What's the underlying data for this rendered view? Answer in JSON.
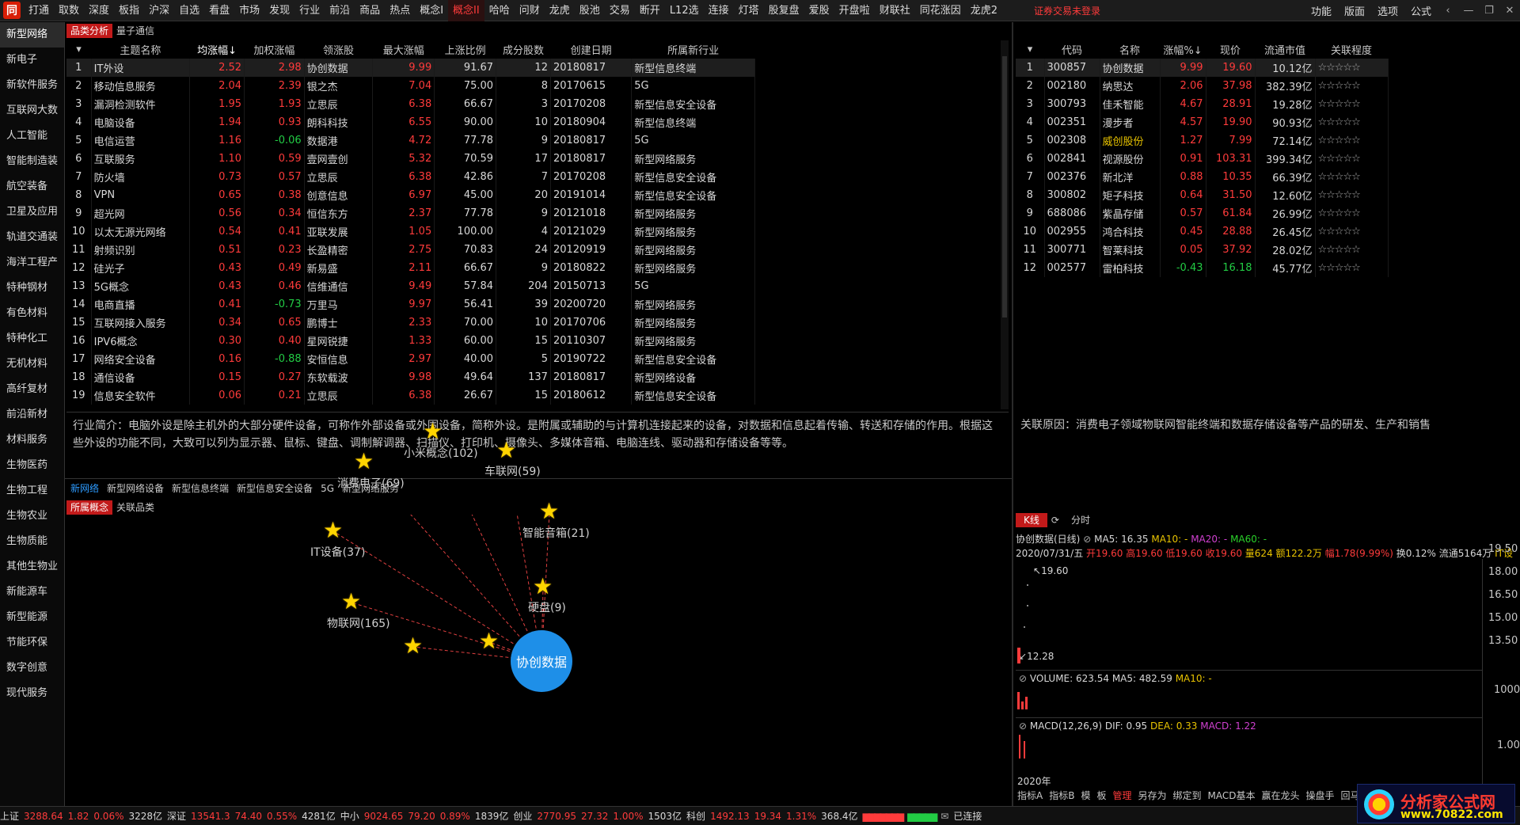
{
  "menubar": {
    "items": [
      "打通",
      "取数",
      "深度",
      "板指",
      "沪深",
      "自选",
      "看盘",
      "市场",
      "发现",
      "行业",
      "前沿",
      "商品",
      "热点",
      "概念I",
      "概念II",
      "哈哈",
      "问财",
      "龙虎",
      "股池",
      "交易",
      "断开",
      "L12选",
      "连接",
      "灯塔",
      "股复盘",
      "爱股",
      "开盘啦",
      "财联社",
      "同花涨因",
      "龙虎2"
    ],
    "active_index": 14,
    "center_text": "证券交易未登录",
    "right_items": [
      "功能",
      "版面",
      "选项",
      "公式"
    ]
  },
  "sidebar": {
    "items": [
      "新型网络",
      "新电子",
      "新软件服务",
      "互联网大数",
      "人工智能",
      "智能制造装",
      "航空装备",
      "卫星及应用",
      "轨道交通装",
      "海洋工程产",
      "特种钢材",
      "有色材料",
      "特种化工",
      "无机材料",
      "高纤复材",
      "前沿新材",
      "材料服务",
      "生物医药",
      "生物工程",
      "生物农业",
      "生物质能",
      "其他生物业",
      "新能源车",
      "新型能源",
      "节能环保",
      "数字创意",
      "现代服务"
    ],
    "active_index": 0
  },
  "top_tabs": [
    "品类分析",
    "量子通信"
  ],
  "main_table": {
    "headers": [
      "",
      "主题名称",
      "均涨幅↓",
      "加权涨幅",
      "领涨股",
      "最大涨幅",
      "上涨比例",
      "成分股数",
      "创建日期",
      "所属新行业"
    ],
    "rows": [
      [
        "1",
        "IT外设",
        "2.52",
        "2.98",
        "协创数据",
        "9.99",
        "91.67",
        "12",
        "20180817",
        "新型信息终端"
      ],
      [
        "2",
        "移动信息服务",
        "2.04",
        "2.39",
        "银之杰",
        "7.04",
        "75.00",
        "8",
        "20170615",
        "5G"
      ],
      [
        "3",
        "漏洞检测软件",
        "1.95",
        "1.93",
        "立思辰",
        "6.38",
        "66.67",
        "3",
        "20170208",
        "新型信息安全设备"
      ],
      [
        "4",
        "电脑设备",
        "1.94",
        "0.93",
        "朗科科技",
        "6.55",
        "90.00",
        "10",
        "20180904",
        "新型信息终端"
      ],
      [
        "5",
        "电信运营",
        "1.16",
        "-0.06",
        "数据港",
        "4.72",
        "77.78",
        "9",
        "20180817",
        "5G"
      ],
      [
        "6",
        "互联服务",
        "1.10",
        "0.59",
        "壹网壹创",
        "5.32",
        "70.59",
        "17",
        "20180817",
        "新型网络服务"
      ],
      [
        "7",
        "防火墙",
        "0.73",
        "0.57",
        "立思辰",
        "6.38",
        "42.86",
        "7",
        "20170208",
        "新型信息安全设备"
      ],
      [
        "8",
        "VPN",
        "0.65",
        "0.38",
        "创意信息",
        "6.97",
        "45.00",
        "20",
        "20191014",
        "新型信息安全设备"
      ],
      [
        "9",
        "超光网",
        "0.56",
        "0.34",
        "恒信东方",
        "2.37",
        "77.78",
        "9",
        "20121018",
        "新型网络服务"
      ],
      [
        "10",
        "以太无源光网络",
        "0.54",
        "0.41",
        "亚联发展",
        "1.05",
        "100.00",
        "4",
        "20121029",
        "新型网络服务"
      ],
      [
        "11",
        "射频识别",
        "0.51",
        "0.23",
        "长盈精密",
        "2.75",
        "70.83",
        "24",
        "20120919",
        "新型网络服务"
      ],
      [
        "12",
        "硅光子",
        "0.43",
        "0.49",
        "新易盛",
        "2.11",
        "66.67",
        "9",
        "20180822",
        "新型网络服务"
      ],
      [
        "13",
        "5G概念",
        "0.43",
        "0.46",
        "信维通信",
        "9.49",
        "57.84",
        "204",
        "20150713",
        "5G"
      ],
      [
        "14",
        "电商直播",
        "0.41",
        "-0.73",
        "万里马",
        "9.97",
        "56.41",
        "39",
        "20200720",
        "新型网络服务"
      ],
      [
        "15",
        "互联网接入服务",
        "0.34",
        "0.65",
        "鹏博士",
        "2.33",
        "70.00",
        "10",
        "20170706",
        "新型网络服务"
      ],
      [
        "16",
        "IPV6概念",
        "0.30",
        "0.40",
        "星网锐捷",
        "1.33",
        "60.00",
        "15",
        "20110307",
        "新型网络服务"
      ],
      [
        "17",
        "网络安全设备",
        "0.16",
        "-0.88",
        "安恒信息",
        "2.97",
        "40.00",
        "5",
        "20190722",
        "新型信息安全设备"
      ],
      [
        "18",
        "通信设备",
        "0.15",
        "0.27",
        "东软载波",
        "9.98",
        "49.64",
        "137",
        "20180817",
        "新型网络设备"
      ],
      [
        "19",
        "信息安全软件",
        "0.06",
        "0.21",
        "立思辰",
        "6.38",
        "26.67",
        "15",
        "20180612",
        "新型信息安全设备"
      ]
    ]
  },
  "description": "行业简介：电脑外设是除主机外的大部分硬件设备，可称作外部设备或外围设备，简称外设。是附属或辅助的与计算机连接起来的设备，对数据和信息起着传输、转送和存储的作用。根据这些外设的功能不同，大致可以列为显示器、鼠标、键盘、调制解调器、扫描仪、打印机、摄像头、多媒体音箱、电脑连线、驱动器和存储设备等等。",
  "industry_tabs": [
    "新网络",
    "新型网络设备",
    "新型信息终端",
    "新型信息安全设备",
    "5G",
    "新型网络服务"
  ],
  "graph_tabs": [
    "所属概念",
    "关联品类"
  ],
  "stock_table": {
    "headers": [
      "",
      "代码",
      "名称",
      "涨幅%↓",
      "现价",
      "流通市值",
      "关联程度"
    ],
    "rows": [
      [
        "1",
        "300857",
        "协创数据",
        "9.99",
        "19.60",
        "10.12亿",
        "☆☆☆☆☆"
      ],
      [
        "2",
        "002180",
        "纳思达",
        "2.06",
        "37.98",
        "382.39亿",
        "☆☆☆☆☆"
      ],
      [
        "3",
        "300793",
        "佳禾智能",
        "4.67",
        "28.91",
        "19.28亿",
        "☆☆☆☆☆"
      ],
      [
        "4",
        "002351",
        "漫步者",
        "4.57",
        "19.90",
        "90.93亿",
        "☆☆☆☆☆"
      ],
      [
        "5",
        "002308",
        "威创股份",
        "1.27",
        "7.99",
        "72.14亿",
        "☆☆☆☆☆"
      ],
      [
        "6",
        "002841",
        "视源股份",
        "0.91",
        "103.31",
        "399.34亿",
        "☆☆☆☆☆"
      ],
      [
        "7",
        "002376",
        "新北洋",
        "0.88",
        "10.35",
        "66.39亿",
        "☆☆☆☆☆"
      ],
      [
        "8",
        "300802",
        "矩子科技",
        "0.64",
        "31.50",
        "12.60亿",
        "☆☆☆☆☆"
      ],
      [
        "9",
        "688086",
        "紫晶存储",
        "0.57",
        "61.84",
        "26.99亿",
        "☆☆☆☆☆"
      ],
      [
        "10",
        "002955",
        "鸿合科技",
        "0.45",
        "28.88",
        "26.45亿",
        "☆☆☆☆☆"
      ],
      [
        "11",
        "300771",
        "智莱科技",
        "0.05",
        "37.92",
        "28.02亿",
        "☆☆☆☆☆"
      ],
      [
        "12",
        "002577",
        "雷柏科技",
        "-0.43",
        "16.18",
        "45.77亿",
        "☆☆☆☆☆"
      ]
    ]
  },
  "reason": "关联原因：消费电子领域物联网智能终端和数据存储设备等产品的研发、生产和销售",
  "graph": {
    "center": "协创数据",
    "nodes": [
      "小米概念(102)",
      "车联网(59)",
      "消费电子(69)",
      "智能音箱(21)",
      "IT设备(37)",
      "硬盘(9)",
      "物联网(165)",
      "",
      ""
    ]
  },
  "kline": {
    "tabs": [
      "K线",
      "分时"
    ],
    "title": "协创数据(日线)",
    "ma5": "MA5: 16.35",
    "ma10": "MA10: -",
    "ma20": "MA20: -",
    "ma60": "MA60: -",
    "info_date": "2020/07/31/五",
    "info_open": "开19.60",
    "info_high": "高19.60",
    "info_low": "低19.60",
    "info_close": "收19.60",
    "info_vol": "量624",
    "info_amount": "额122.2万",
    "info_change": "幅1.78(9.99%)",
    "info_turn": "换0.12%",
    "info_float": "流通5164万",
    "info_code": "IT设",
    "price_high": "19.60",
    "price_low": "12.28",
    "y_labels": [
      "19.50",
      "18.00",
      "16.50",
      "15.00",
      "13.50"
    ],
    "volume_title": "VOLUME: 623.54",
    "volume_ma5": "MA5: 482.59",
    "volume_ma10": "MA10: -",
    "volume_label": "1000",
    "macd_title": "MACD(12,26,9)",
    "macd_dif": "DIF: 0.95",
    "macd_dea": "DEA: 0.33",
    "macd_val": "MACD: 1.22",
    "macd_label": "1.00",
    "year": "2020年",
    "tools": [
      "指标A",
      "指标B",
      "模",
      "板",
      "管理",
      "另存为",
      "绑定到",
      "MACD基本",
      "赢在龙头",
      "操盘手",
      "回马枪"
    ]
  },
  "status": {
    "sh_label": "上证",
    "sh_val": "3288.64",
    "sh_chg": "1.82",
    "sh_pct": "0.06%",
    "sh_amt": "3228亿",
    "sz_label": "深证",
    "sz_val": "13541.3",
    "sz_chg": "74.40",
    "sz_pct": "0.55%",
    "sz_amt": "4281亿",
    "zx_label": "中小",
    "zx_val": "9024.65",
    "zx_chg": "79.20",
    "zx_pct": "0.89%",
    "zx_amt": "1839亿",
    "cy_label": "创业",
    "cy_val": "2770.95",
    "cy_chg": "27.32",
    "cy_pct": "1.00%",
    "cy_amt": "1503亿",
    "kc_label": "科创",
    "kc_val": "1492.13",
    "kc_chg": "19.34",
    "kc_pct": "1.31%",
    "kc_amt": "368.4亿",
    "conn": "已连接"
  },
  "watermark": {
    "name": "分析家公式网",
    "url": "www.70822.com"
  }
}
